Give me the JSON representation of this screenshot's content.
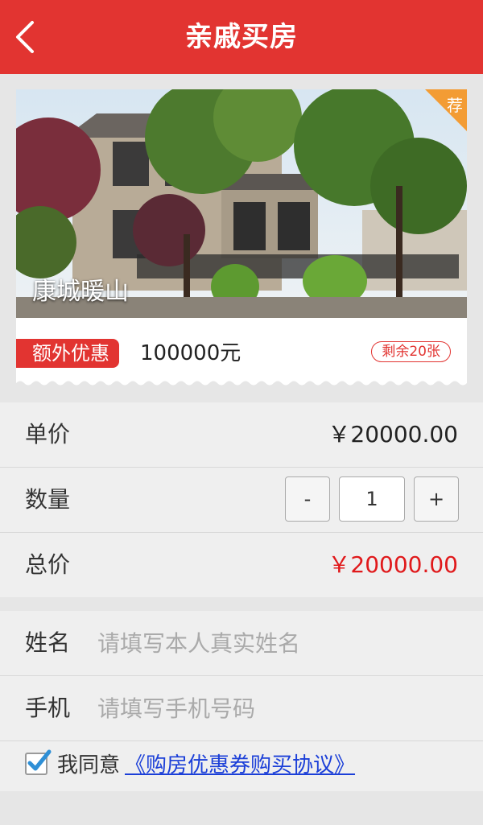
{
  "header": {
    "title": "亲戚买房",
    "back_icon": "chevron-left-icon"
  },
  "colors": {
    "brand_red": "#e23431",
    "badge_orange": "#f39c34",
    "link_blue": "#1b3fd8"
  },
  "card": {
    "estate_name": "康城暖山",
    "corner_badge": "荐",
    "promo_tag": "额外优惠",
    "promo_amount": "100000元",
    "remaining": "剩余20张"
  },
  "price": {
    "unit_label": "单价",
    "unit_value": "￥20000.00",
    "qty_label": "数量",
    "minus": "-",
    "qty_value": "1",
    "plus": "+",
    "total_label": "总价",
    "total_value": "￥20000.00"
  },
  "form": {
    "name_label": "姓名",
    "name_placeholder": "请填写本人真实姓名",
    "phone_label": "手机",
    "phone_placeholder": "请填写手机号码",
    "agree_prefix": "我同意",
    "agree_link": "《购房优惠券购买协议》",
    "agree_checked": true
  }
}
